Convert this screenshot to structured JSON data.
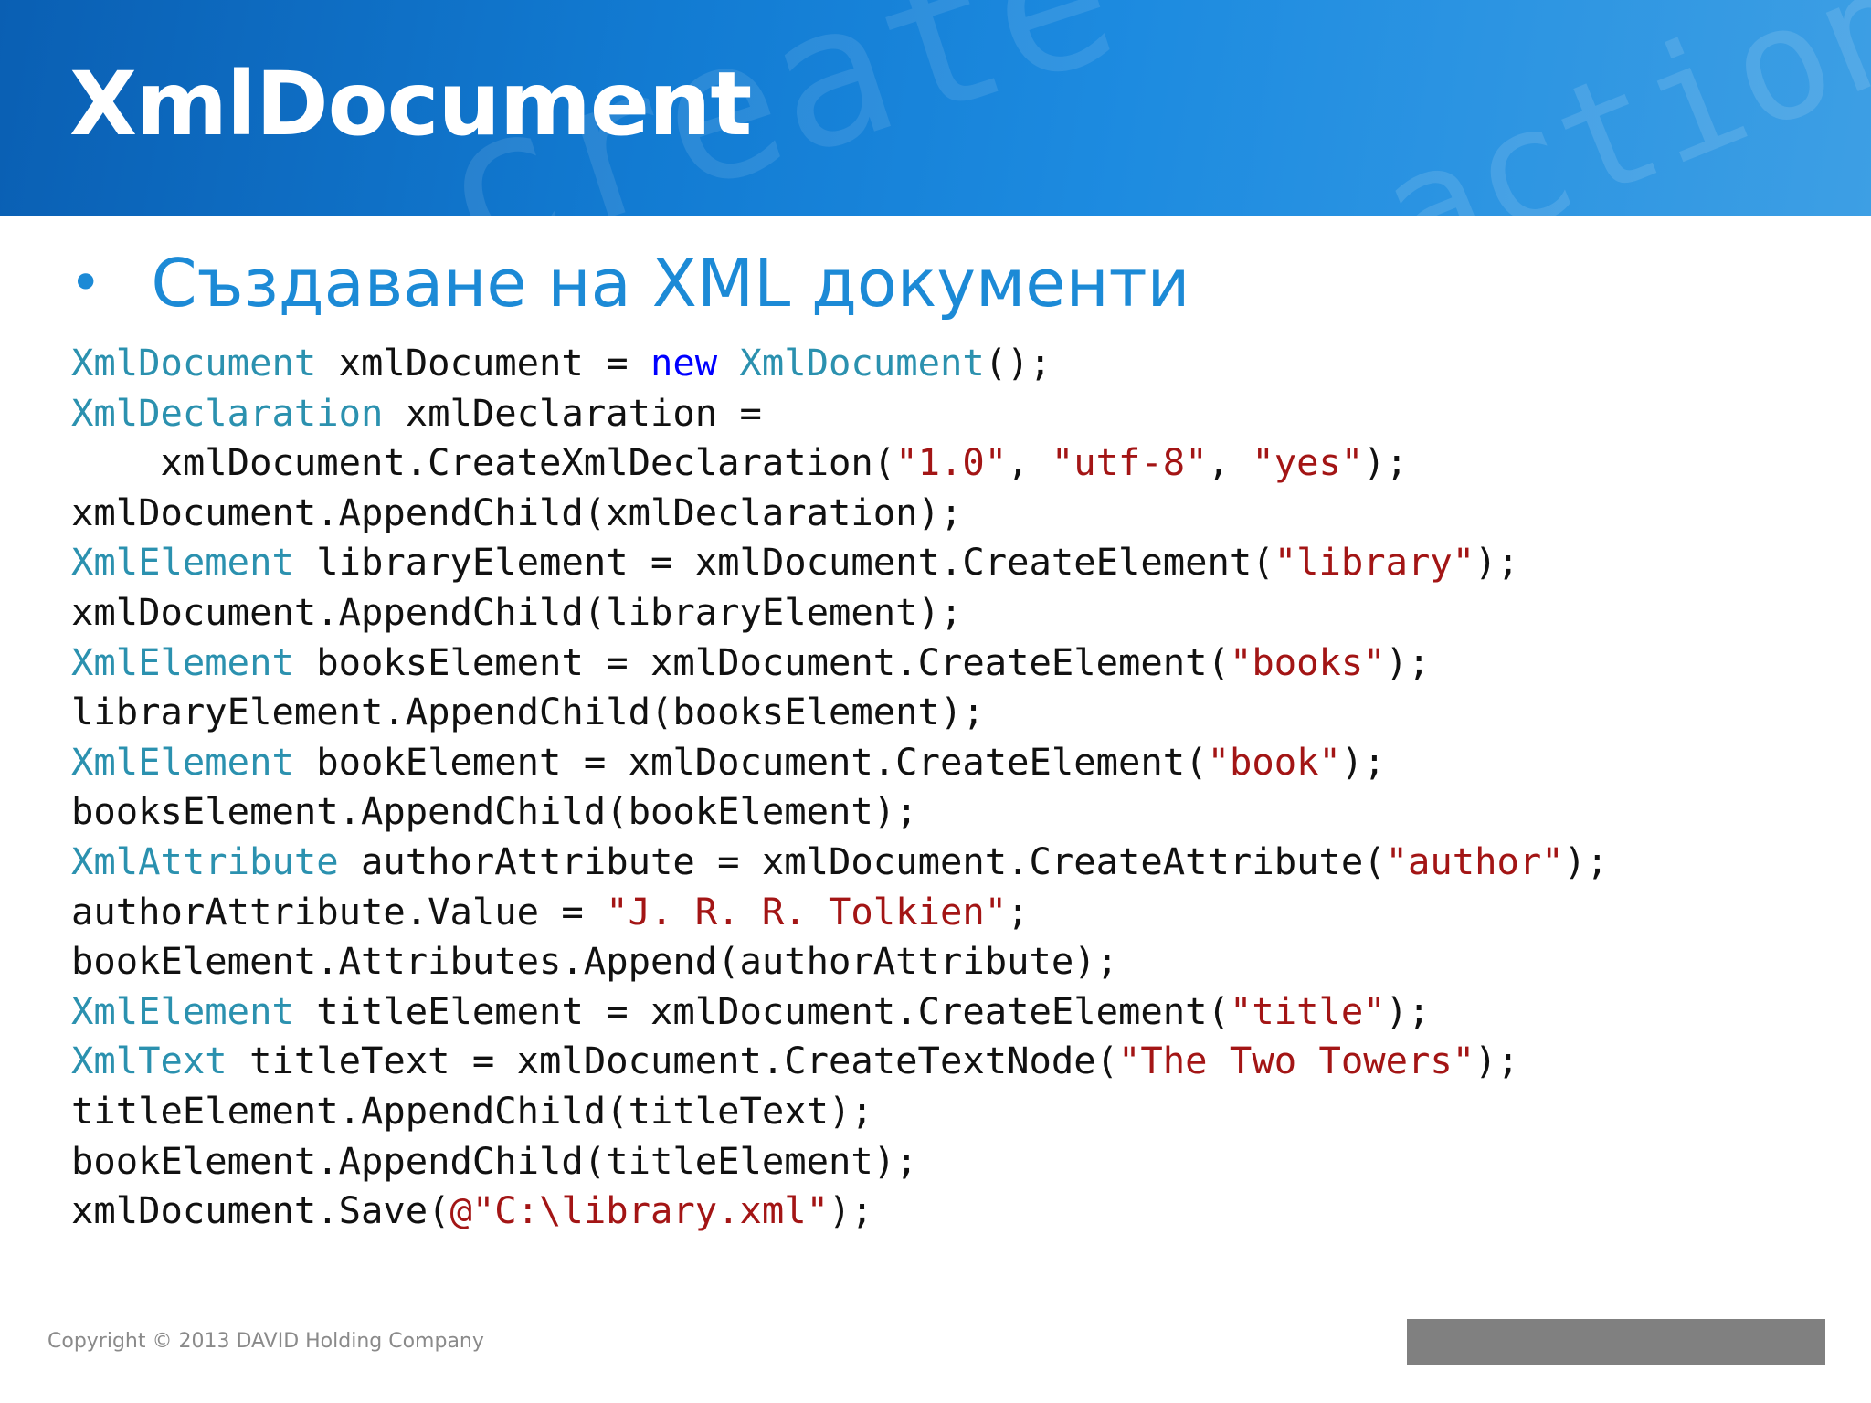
{
  "slide": {
    "title": "XmlDocument",
    "watermark_text_1": "create",
    "watermark_text_2": "action",
    "bullet": "Създаване на XML документи",
    "colors": {
      "header_blue": "#127bd2",
      "bullet_blue": "#1c8ad6",
      "code_type": "#2b91af",
      "code_keyword": "#0000ff",
      "code_string": "#a31515",
      "code_plain": "#111111",
      "footer_bar": "#808080"
    },
    "footer": {
      "copyright": "Copyright © 2013 DAVID Holding Company"
    }
  },
  "code_lines": [
    [
      [
        "type",
        "XmlDocument"
      ],
      [
        "plain",
        " xmlDocument = "
      ],
      [
        "kw",
        "new"
      ],
      [
        "plain",
        " "
      ],
      [
        "type",
        "XmlDocument"
      ],
      [
        "plain",
        "();"
      ]
    ],
    [
      [
        "type",
        "XmlDeclaration"
      ],
      [
        "plain",
        " xmlDeclaration ="
      ]
    ],
    [
      [
        "plain",
        "    xmlDocument.CreateXmlDeclaration("
      ],
      [
        "str",
        "\"1.0\""
      ],
      [
        "plain",
        ", "
      ],
      [
        "str",
        "\"utf-8\""
      ],
      [
        "plain",
        ", "
      ],
      [
        "str",
        "\"yes\""
      ],
      [
        "plain",
        ");"
      ]
    ],
    [
      [
        "plain",
        "xmlDocument.AppendChild(xmlDeclaration);"
      ]
    ],
    [
      [
        "type",
        "XmlElement"
      ],
      [
        "plain",
        " libraryElement = xmlDocument.CreateElement("
      ],
      [
        "str",
        "\"library\""
      ],
      [
        "plain",
        ");"
      ]
    ],
    [
      [
        "plain",
        "xmlDocument.AppendChild(libraryElement);"
      ]
    ],
    [
      [
        "type",
        "XmlElement"
      ],
      [
        "plain",
        " booksElement = xmlDocument.CreateElement("
      ],
      [
        "str",
        "\"books\""
      ],
      [
        "plain",
        ");"
      ]
    ],
    [
      [
        "plain",
        "libraryElement.AppendChild(booksElement);"
      ]
    ],
    [
      [
        "type",
        "XmlElement"
      ],
      [
        "plain",
        " bookElement = xmlDocument.CreateElement("
      ],
      [
        "str",
        "\"book\""
      ],
      [
        "plain",
        ");"
      ]
    ],
    [
      [
        "plain",
        "booksElement.AppendChild(bookElement);"
      ]
    ],
    [
      [
        "type",
        "XmlAttribute"
      ],
      [
        "plain",
        " authorAttribute = xmlDocument.CreateAttribute("
      ],
      [
        "str",
        "\"author\""
      ],
      [
        "plain",
        ");"
      ]
    ],
    [
      [
        "plain",
        "authorAttribute.Value = "
      ],
      [
        "str",
        "\"J. R. R. Tolkien\""
      ],
      [
        "plain",
        ";"
      ]
    ],
    [
      [
        "plain",
        "bookElement.Attributes.Append(authorAttribute);"
      ]
    ],
    [
      [
        "type",
        "XmlElement"
      ],
      [
        "plain",
        " titleElement = xmlDocument.CreateElement("
      ],
      [
        "str",
        "\"title\""
      ],
      [
        "plain",
        ");"
      ]
    ],
    [
      [
        "type",
        "XmlText"
      ],
      [
        "plain",
        " titleText = xmlDocument.CreateTextNode("
      ],
      [
        "str",
        "\"The Two Towers\""
      ],
      [
        "plain",
        ");"
      ]
    ],
    [
      [
        "plain",
        "titleElement.AppendChild(titleText);"
      ]
    ],
    [
      [
        "plain",
        "bookElement.AppendChild(titleElement);"
      ]
    ],
    [
      [
        "plain",
        "xmlDocument.Save("
      ],
      [
        "str",
        "@\"C:\\library.xml\""
      ],
      [
        "plain",
        ");"
      ]
    ]
  ]
}
